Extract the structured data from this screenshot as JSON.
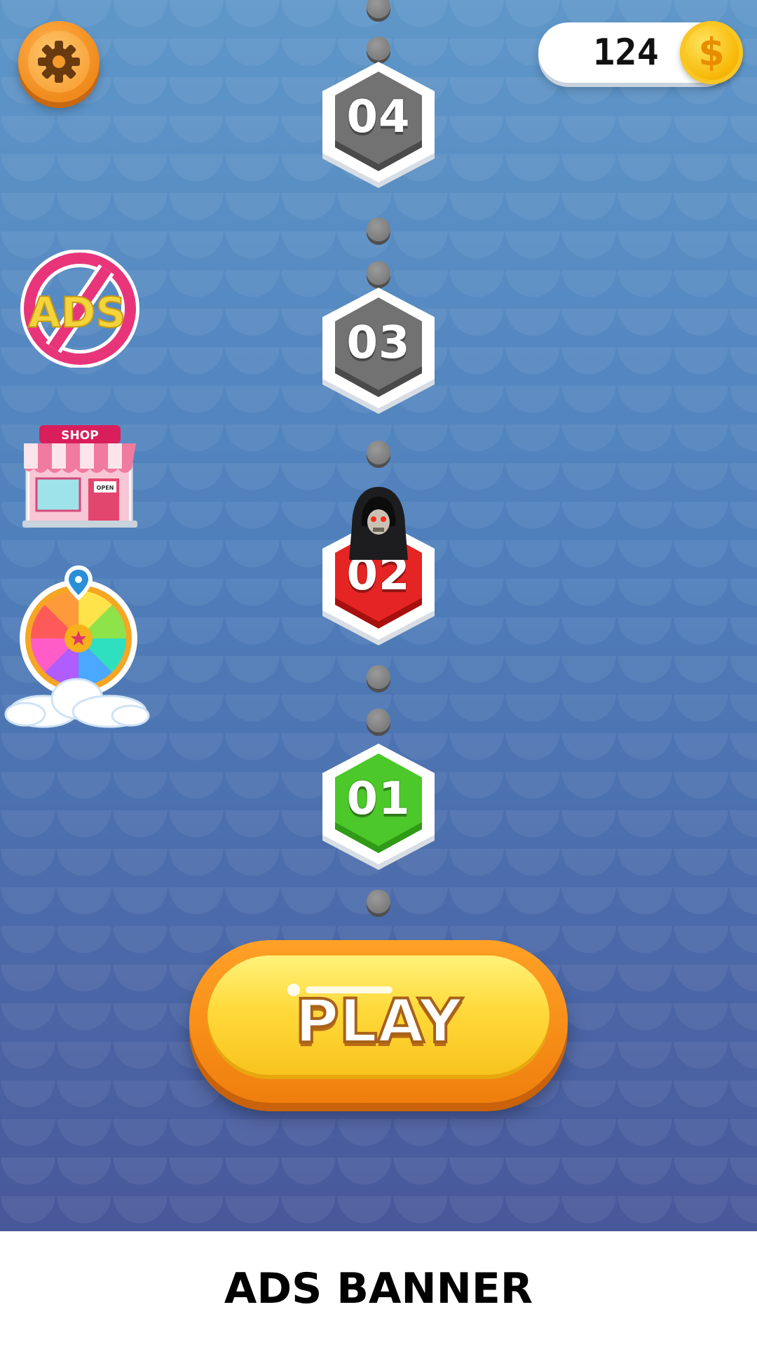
{
  "hud": {
    "coins": "124",
    "coin_symbol": "$"
  },
  "side_menu": {
    "ads_label": "ADS",
    "shop_sign": "SHOP",
    "shop_door_sign": "OPEN"
  },
  "levels": [
    {
      "number": "04",
      "state": "locked",
      "color": "#6b6b6b"
    },
    {
      "number": "03",
      "state": "locked",
      "color": "#6b6b6b"
    },
    {
      "number": "02",
      "state": "current",
      "color": "#e52424"
    },
    {
      "number": "01",
      "state": "completed",
      "color": "#4cc82a"
    }
  ],
  "play_button": {
    "label": "PLAY"
  },
  "banner": {
    "text": "ADS BANNER"
  },
  "colors": {
    "background_top": "#5f97c9",
    "background_bottom": "#48589a",
    "play_button": "#ffd93a",
    "accent_orange": "#f08a1c"
  }
}
